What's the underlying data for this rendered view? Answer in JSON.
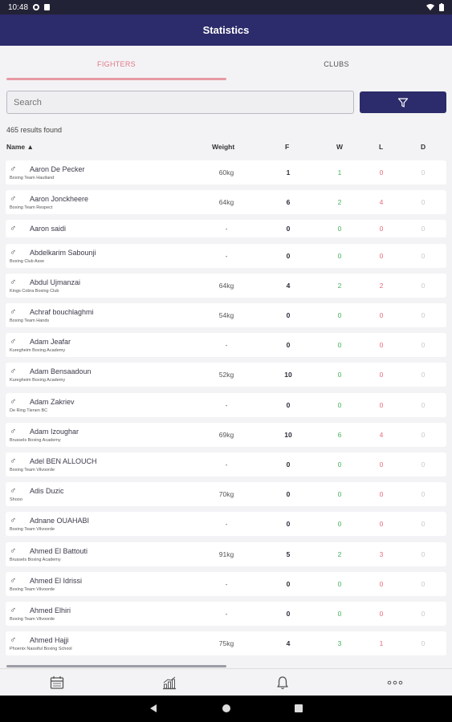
{
  "status_bar": {
    "time": "10:48"
  },
  "app_bar": {
    "title": "Statistics"
  },
  "tabs": [
    {
      "label": "FIGHTERS",
      "active": true
    },
    {
      "label": "CLUBS",
      "active": false
    }
  ],
  "search": {
    "placeholder": "Search"
  },
  "results_text": "465 results found",
  "columns": {
    "name": "Name ▲",
    "weight": "Weight",
    "f": "F",
    "w": "W",
    "l": "L",
    "d": "D"
  },
  "fighters": [
    {
      "name": "Aaron De Pecker",
      "club": "Boxing Team Hautland",
      "weight": "60kg",
      "f": "1",
      "w": "1",
      "l": "0",
      "d": "0"
    },
    {
      "name": "Aaron Jonckheere",
      "club": "Boxing Team Respect",
      "weight": "64kg",
      "f": "6",
      "w": "2",
      "l": "4",
      "d": "0"
    },
    {
      "name": "Aaron saidi",
      "club": "",
      "weight": "-",
      "f": "0",
      "w": "0",
      "l": "0",
      "d": "0"
    },
    {
      "name": "Abdelkarim Sabounji",
      "club": "Boxing Club Asse",
      "weight": "-",
      "f": "0",
      "w": "0",
      "l": "0",
      "d": "0"
    },
    {
      "name": "Abdul Ujmanzai",
      "club": "Kings Cobra Boxing Club",
      "weight": "64kg",
      "f": "4",
      "w": "2",
      "l": "2",
      "d": "0"
    },
    {
      "name": "Achraf bouchlaghmi",
      "club": "Boxing Team Hands",
      "weight": "54kg",
      "f": "0",
      "w": "0",
      "l": "0",
      "d": "0"
    },
    {
      "name": "Adam Jeafar",
      "club": "Kuregheim Boxing Academy",
      "weight": "-",
      "f": "0",
      "w": "0",
      "l": "0",
      "d": "0"
    },
    {
      "name": "Adam Bensaadoun",
      "club": "Kuregheim Boxing Academy",
      "weight": "52kg",
      "f": "10",
      "w": "0",
      "l": "0",
      "d": "0"
    },
    {
      "name": "Adam Zakriev",
      "club": "De Ring Tienen BC",
      "weight": "-",
      "f": "0",
      "w": "0",
      "l": "0",
      "d": "0"
    },
    {
      "name": "Adam Izoughar",
      "club": "Brussels Boxing Academy",
      "weight": "69kg",
      "f": "10",
      "w": "6",
      "l": "4",
      "d": "0"
    },
    {
      "name": "Adel BEN ALLOUCH",
      "club": "Boxing Team Vilvoorde",
      "weight": "-",
      "f": "0",
      "w": "0",
      "l": "0",
      "d": "0"
    },
    {
      "name": "Adis Duzic",
      "club": "Shooo",
      "weight": "70kg",
      "f": "0",
      "w": "0",
      "l": "0",
      "d": "0"
    },
    {
      "name": "Adnane OUAHABI",
      "club": "Boxing Team Vilvoorde",
      "weight": "-",
      "f": "0",
      "w": "0",
      "l": "0",
      "d": "0"
    },
    {
      "name": "Ahmed El Battouti",
      "club": "Brussels Boxing Academy",
      "weight": "91kg",
      "f": "5",
      "w": "2",
      "l": "3",
      "d": "0"
    },
    {
      "name": "Ahmed El Idrissi",
      "club": "Boxing Team Vilvoorde",
      "weight": "-",
      "f": "0",
      "w": "0",
      "l": "0",
      "d": "0"
    },
    {
      "name": "Ahmed Elhiri",
      "club": "Boxing Team Vilvoorde",
      "weight": "-",
      "f": "0",
      "w": "0",
      "l": "0",
      "d": "0"
    },
    {
      "name": "Ahmed Hajji",
      "club": "Phoenix Nassiful Boxing School",
      "weight": "75kg",
      "f": "4",
      "w": "3",
      "l": "1",
      "d": "0"
    }
  ],
  "icons": {
    "gender": "male-symbol-icon",
    "filter": "filter-icon",
    "calendar": "calendar-icon",
    "stats": "chart-icon",
    "bell": "bell-icon",
    "more": "more-icon"
  },
  "colors": {
    "primary": "#2c2b6b",
    "active_tab": "#e07a87",
    "win": "#45b25a",
    "loss": "#e86a7c"
  }
}
